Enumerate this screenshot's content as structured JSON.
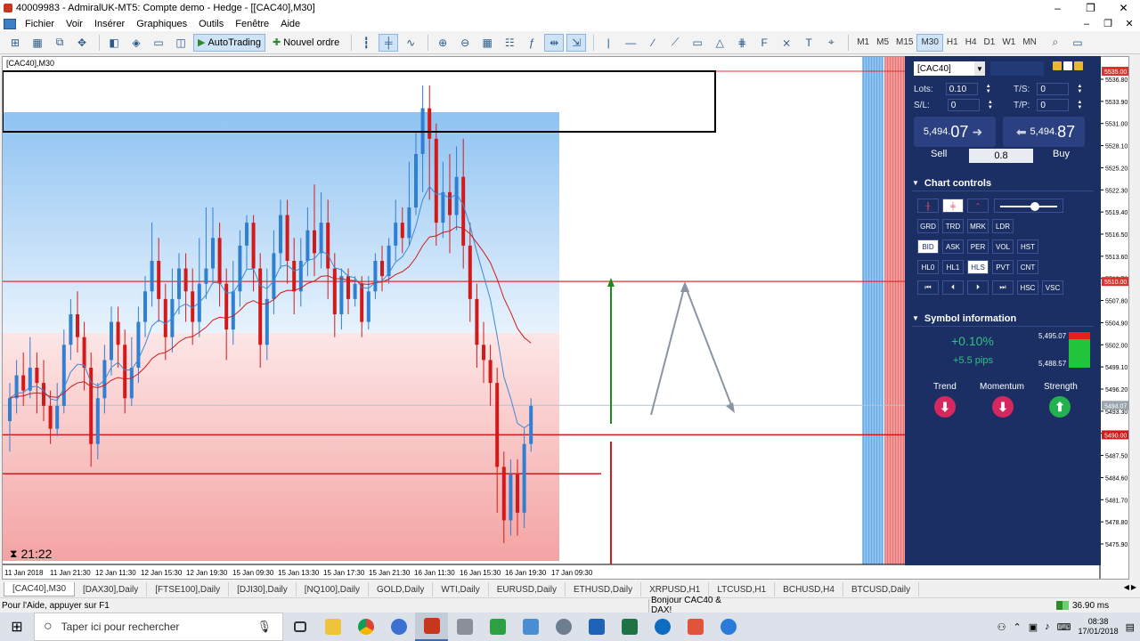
{
  "window": {
    "title": "40009983 - AdmiralUK-MT5: Compte demo - Hedge - [[CAC40],M30]",
    "controls": [
      "–",
      "❐",
      "✕"
    ]
  },
  "menu": {
    "items": [
      "Fichier",
      "Voir",
      "Insérer",
      "Graphiques",
      "Outils",
      "Fenêtre",
      "Aide"
    ],
    "controls": [
      "–",
      "❐",
      "✕"
    ]
  },
  "toolbar": {
    "autotrading_label": "AutoTrading",
    "new_order_label": "Nouvel ordre",
    "timeframes": [
      "M1",
      "M5",
      "M15",
      "M30",
      "H1",
      "H4",
      "D1",
      "W1",
      "MN"
    ],
    "selected_timeframe": "M30"
  },
  "chart": {
    "caption": "[CAC40],M30",
    "timer": "21:22",
    "time_labels": [
      "11 Jan 2018",
      "11 Jan 21:30",
      "12 Jan 11:30",
      "12 Jan 15:30",
      "12 Jan 19:30",
      "15 Jan 09:30",
      "15 Jan 13:30",
      "15 Jan 17:30",
      "15 Jan 21:30",
      "16 Jan 11:30",
      "16 Jan 15:30",
      "16 Jan 19:30",
      "17 Jan 09:30"
    ],
    "price_labels": [
      "5536.80",
      "5533.90",
      "5531.00",
      "5528.10",
      "5525.20",
      "5522.30",
      "5519.40",
      "5516.50",
      "5513.60",
      "5510.70",
      "5507.80",
      "5504.90",
      "5502.00",
      "5499.10",
      "5496.20",
      "5493.30",
      "5490.40",
      "5487.50",
      "5484.60",
      "5481.70",
      "5478.80",
      "5475.90"
    ],
    "price_tags": {
      "top": "5535.00",
      "mid": "5510.00",
      "current": "5494.07",
      "low": "5490.00"
    }
  },
  "panel": {
    "symbol": "[CAC40]",
    "lots_label": "Lots:",
    "lots_value": "0.10",
    "ts_label": "T/S:",
    "ts_value": "0",
    "sl_label": "S/L:",
    "sl_value": "0",
    "tp_label": "T/P:",
    "tp_value": "0",
    "sell_price_small": "5,494.",
    "sell_price_big": "07",
    "buy_price_small": "5,494.",
    "buy_price_big": "87",
    "sell_label": "Sell",
    "buy_label": "Buy",
    "spread": "0.8",
    "chart_controls_title": "Chart controls",
    "cc_row2": [
      "GRD",
      "TRD",
      "MRK",
      "LDR"
    ],
    "cc_row3": [
      "BID",
      "ASK",
      "PER",
      "VOL",
      "HST"
    ],
    "cc_row4": [
      "HL0",
      "HL1",
      "HLS",
      "PVT",
      "CNT"
    ],
    "cc_row5": [
      "⏮",
      "⏴",
      "⏵",
      "⏭",
      "HSC",
      "VSC"
    ],
    "symbol_info_title": "Symbol information",
    "change_pct": "+0.10%",
    "change_pips": "+5.5 pips",
    "high": "5,495.07",
    "low": "5,488.57",
    "trend_label": "Trend",
    "momentum_label": "Momentum",
    "strength_label": "Strength"
  },
  "tabs": {
    "items": [
      "[CAC40],M30",
      "[DAX30],Daily",
      "[FTSE100],Daily",
      "[DJI30],Daily",
      "[NQ100],Daily",
      "GOLD,Daily",
      "WTI,Daily",
      "EURUSD,Daily",
      "ETHUSD,Daily",
      "XRPUSD,H1",
      "LTCUSD,H1",
      "BCHUSD,H4",
      "BTCUSD,Daily"
    ],
    "active": "[CAC40],M30"
  },
  "status": {
    "help": "Pour l'Aide, appuyer sur F1",
    "message": "Bonjour CAC40 & DAX!",
    "ping": "36.90 ms"
  },
  "taskbar": {
    "search_placeholder": "Taper ici pour rechercher",
    "time": "08:38",
    "date": "17/01/2018"
  },
  "colors": {
    "panel_bg": "#1b2f64",
    "bull": "#2f7fd3",
    "bear": "#d21a1a",
    "blue_zone": "#8fc3f2",
    "red_zone": "#f4a3a3"
  }
}
